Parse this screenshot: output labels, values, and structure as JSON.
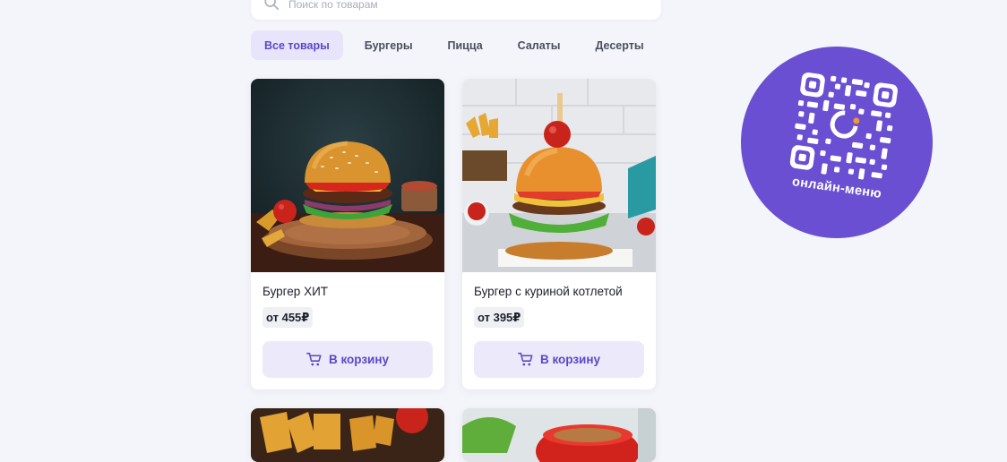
{
  "search": {
    "placeholder": "Поиск по товарам"
  },
  "tabs": [
    {
      "label": "Все товары",
      "active": true
    },
    {
      "label": "Бургеры",
      "active": false
    },
    {
      "label": "Пицца",
      "active": false
    },
    {
      "label": "Салаты",
      "active": false
    },
    {
      "label": "Десерты",
      "active": false
    }
  ],
  "products": [
    {
      "name": "Бургер ХИТ",
      "price": "от 455₽",
      "button": "В корзину",
      "icon": "cart-icon"
    },
    {
      "name": "Бургер с куриной котлетой",
      "price": "от 395₽",
      "button": "В корзину",
      "icon": "cart-icon"
    }
  ],
  "qr_badge": {
    "caption": "онлайн-меню",
    "icon": "qr-code-icon"
  },
  "colors": {
    "accent": "#6a4fd2",
    "accent_light": "#ece9fb",
    "background": "#f4f5fa"
  }
}
